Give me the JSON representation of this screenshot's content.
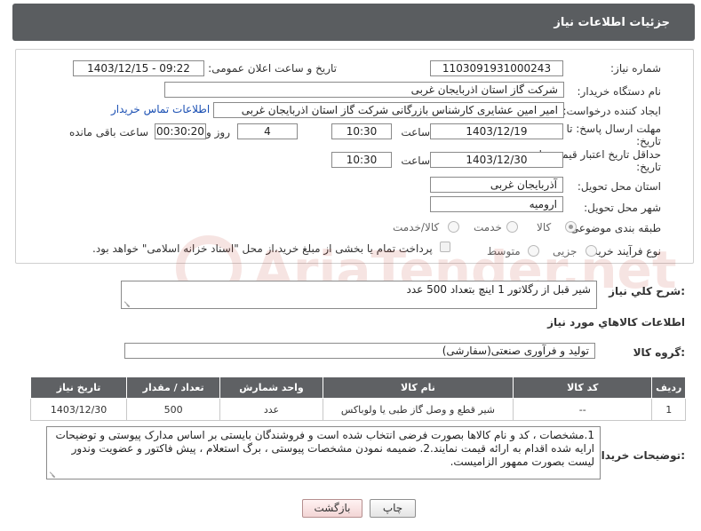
{
  "header": {
    "title": "جزئیات اطلاعات نیاز"
  },
  "form": {
    "need_number_label": "شماره نیاز:",
    "need_number": "1103091931000243",
    "announce_label": "تاریخ و ساعت اعلان عمومی:",
    "announce_value": "1403/12/15 - 09:22",
    "buyer_org_label": "نام دستگاه خریدار:",
    "buyer_org": "شرکت گاز استان اذربایجان غربی",
    "creator_label": "ایجاد کننده درخواست:",
    "creator": "امیر امین عشایری کارشناس بازرگانی شرکت گاز استان اذربایجان غربی",
    "contact_link": "اطلاعات تماس خریدار",
    "reply_deadline_label_1": "مهلت ارسال پاسخ: تا",
    "reply_deadline_label_2": "تاریخ:",
    "reply_date": "1403/12/19",
    "time_label": "ساعت",
    "reply_time": "10:30",
    "days_value": "4",
    "days_label": "روز و",
    "remaining_value": "00:30:20",
    "remaining_label": "ساعت باقی مانده",
    "price_validity_label_1": "حداقل تاریخ اعتبار قیمت: تا",
    "price_validity_label_2": "تاریخ:",
    "price_date": "1403/12/30",
    "price_time": "10:30",
    "province_label": "استان محل تحویل:",
    "province": "آذربایجان غربی",
    "city_label": "شهر محل تحویل:",
    "city": "ارومیه",
    "category_label": "طبقه بندی موضوعی:",
    "category_options": [
      "کالا",
      "خدمت",
      "کالا/خدمت"
    ],
    "process_label": "نوع فرآیند خرید :",
    "process_options": [
      "جزیی",
      "متوسط"
    ],
    "payment_note": "پرداخت تمام یا بخشی از مبلغ خرید،از محل \"اسناد خزانه اسلامی\" خواهد بود."
  },
  "description": {
    "label": "شرح کلي نياز:",
    "text": "شیر قبل از رگلاتور 1 اینچ بتعداد 500 عدد"
  },
  "goods_info": {
    "title": "اطلاعات کالاهاي مورد نياز"
  },
  "goods_group": {
    "label": "گروه کالا:",
    "value": "تولید و فرآوری صنعتی(سفارشی)"
  },
  "table": {
    "headers": [
      "ردیف",
      "کد کالا",
      "نام کالا",
      "واحد شمارش",
      "تعداد / مقدار",
      "تاریخ نیاز"
    ],
    "rows": [
      [
        "1",
        "--",
        "شیر قطع و وصل گاز طبی یا ولوباکس",
        "عدد",
        "500",
        "1403/12/30"
      ]
    ]
  },
  "buyer_notes": {
    "label": "توضیحات خریدار:",
    "text": "1.مشخصات ، کد و نام کالاها بصورت فرضی انتخاب شده است و فروشندگان بایستی بر اساس مدارک پیوستی و توضیحات ارایه شده اقدام به ارائه قیمت نمایند.2. ضمیمه نمودن مشخصات پیوستی ، برگ استعلام ، پیش فاکتور و عضویت وندور لیست بصورت ممهور الزامیست."
  },
  "buttons": {
    "print": "چاپ",
    "back": "بازگشت"
  },
  "watermark": "AriaTender.net"
}
